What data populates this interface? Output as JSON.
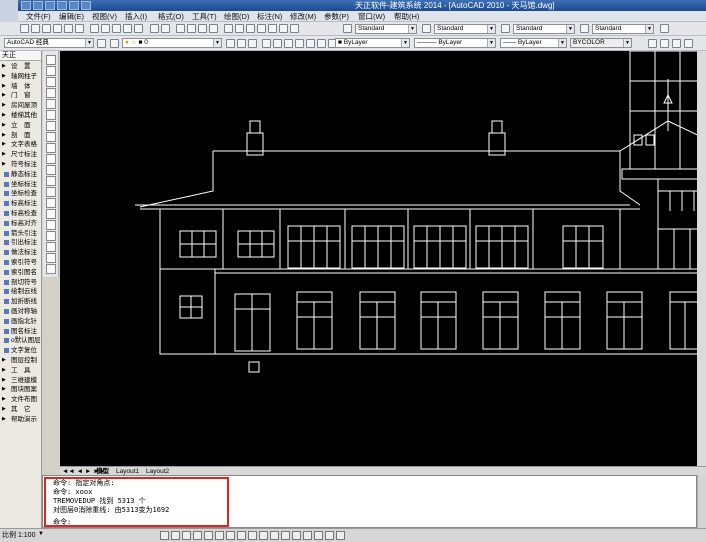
{
  "window": {
    "title": "天正软件-建筑系统 2014 - [AutoCAD 2010 - 天马馆.dwg]"
  },
  "menu": {
    "items": [
      "文件(F)",
      "编辑(E)",
      "视图(V)",
      "插入(I)",
      "格式(O)",
      "工具(T)",
      "绘图(D)",
      "标注(N)",
      "修改(M)",
      "参数(P)",
      "窗口(W)",
      "帮助(H)"
    ]
  },
  "toolbars": {
    "workspace": "AutoCAD 经典",
    "text_style": "Standard",
    "dim_style": "Standard",
    "table_style": "Standard",
    "multileader_style": "Standard",
    "layer": "0",
    "color": "ByLayer",
    "linetype": "ByLayer",
    "lineweight": "ByLayer",
    "plotstyle": "BYCOLOR"
  },
  "palette": {
    "title": "天正",
    "items": [
      {
        "label": "设　置",
        "expandable": true
      },
      {
        "label": "轴网柱子",
        "expandable": true
      },
      {
        "label": "墙　体",
        "expandable": true
      },
      {
        "label": "门　窗",
        "expandable": true
      },
      {
        "label": "房间屋顶",
        "expandable": true
      },
      {
        "label": "楼梯其他",
        "expandable": true
      },
      {
        "label": "立　面",
        "expandable": true
      },
      {
        "label": "剖　面",
        "expandable": true
      },
      {
        "label": "文字表格",
        "expandable": true
      },
      {
        "label": "尺寸标注",
        "expandable": true
      },
      {
        "label": "符号标注",
        "expandable": true
      },
      {
        "label": "静态标注",
        "expandable": false
      },
      {
        "label": "坐标标注",
        "expandable": false
      },
      {
        "label": "坐标检查",
        "expandable": false
      },
      {
        "label": "标高标注",
        "expandable": false
      },
      {
        "label": "标高检查",
        "expandable": false
      },
      {
        "label": "标高对齐",
        "expandable": false
      },
      {
        "label": "箭头引注",
        "expandable": false
      },
      {
        "label": "引出标注",
        "expandable": false
      },
      {
        "label": "做法标注",
        "expandable": false
      },
      {
        "label": "索引符号",
        "expandable": false
      },
      {
        "label": "索引图名",
        "expandable": false
      },
      {
        "label": "剖切符号",
        "expandable": false
      },
      {
        "label": "绘制云线",
        "expandable": false
      },
      {
        "label": "加折断线",
        "expandable": false
      },
      {
        "label": "画对称轴",
        "expandable": false
      },
      {
        "label": "画指北针",
        "expandable": false
      },
      {
        "label": "图名标注",
        "expandable": false
      },
      {
        "label": "o默认图层",
        "expandable": false
      },
      {
        "label": "文字复位",
        "expandable": false
      },
      {
        "label": "图层控制",
        "expandable": true
      },
      {
        "label": "工　具",
        "expandable": true
      },
      {
        "label": "三维建模",
        "expandable": true
      },
      {
        "label": "图块图案",
        "expandable": true
      },
      {
        "label": "文件布图",
        "expandable": true
      },
      {
        "label": "其　它",
        "expandable": true
      },
      {
        "label": "帮助演示",
        "expandable": true
      }
    ]
  },
  "layout_tabs": {
    "model": "模型",
    "layout1": "Layout1",
    "layout2": "Layout2"
  },
  "command_history": [
    "命令: 指定对角点:",
    "命令: xoox",
    "TREMOVEDUP 找到 5313 个",
    "对图层0消除重线: 由5313变为1692",
    "",
    "命令:"
  ],
  "status": {
    "scale": "比例 1:100"
  },
  "colors": {
    "highlight": "#e0241f",
    "canvas": "#000000",
    "drawing_lines": "#ffffff"
  }
}
